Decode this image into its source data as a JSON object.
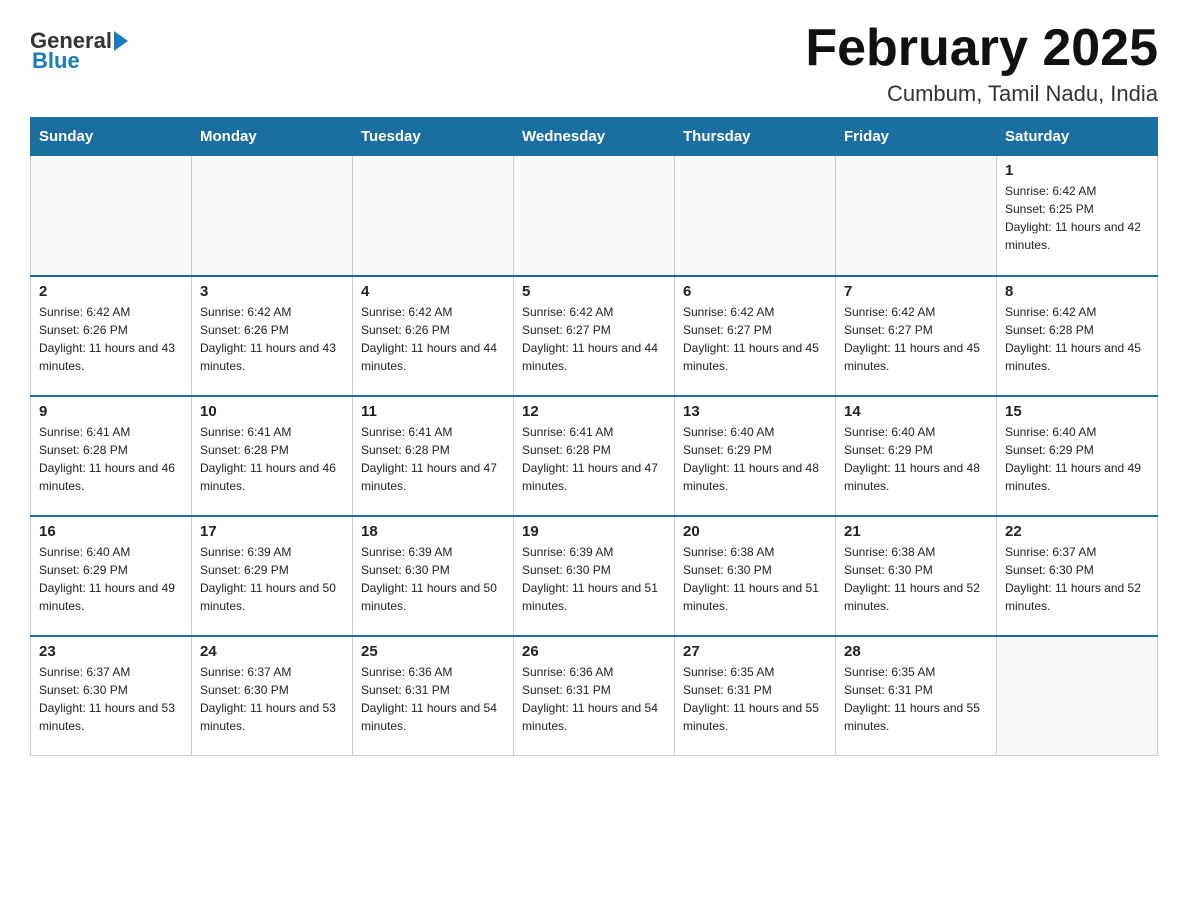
{
  "logo": {
    "general": "General",
    "blue": "Blue"
  },
  "title": "February 2025",
  "location": "Cumbum, Tamil Nadu, India",
  "days_of_week": [
    "Sunday",
    "Monday",
    "Tuesday",
    "Wednesday",
    "Thursday",
    "Friday",
    "Saturday"
  ],
  "weeks": [
    [
      {
        "day": "",
        "info": ""
      },
      {
        "day": "",
        "info": ""
      },
      {
        "day": "",
        "info": ""
      },
      {
        "day": "",
        "info": ""
      },
      {
        "day": "",
        "info": ""
      },
      {
        "day": "",
        "info": ""
      },
      {
        "day": "1",
        "info": "Sunrise: 6:42 AM\nSunset: 6:25 PM\nDaylight: 11 hours and 42 minutes."
      }
    ],
    [
      {
        "day": "2",
        "info": "Sunrise: 6:42 AM\nSunset: 6:26 PM\nDaylight: 11 hours and 43 minutes."
      },
      {
        "day": "3",
        "info": "Sunrise: 6:42 AM\nSunset: 6:26 PM\nDaylight: 11 hours and 43 minutes."
      },
      {
        "day": "4",
        "info": "Sunrise: 6:42 AM\nSunset: 6:26 PM\nDaylight: 11 hours and 44 minutes."
      },
      {
        "day": "5",
        "info": "Sunrise: 6:42 AM\nSunset: 6:27 PM\nDaylight: 11 hours and 44 minutes."
      },
      {
        "day": "6",
        "info": "Sunrise: 6:42 AM\nSunset: 6:27 PM\nDaylight: 11 hours and 45 minutes."
      },
      {
        "day": "7",
        "info": "Sunrise: 6:42 AM\nSunset: 6:27 PM\nDaylight: 11 hours and 45 minutes."
      },
      {
        "day": "8",
        "info": "Sunrise: 6:42 AM\nSunset: 6:28 PM\nDaylight: 11 hours and 45 minutes."
      }
    ],
    [
      {
        "day": "9",
        "info": "Sunrise: 6:41 AM\nSunset: 6:28 PM\nDaylight: 11 hours and 46 minutes."
      },
      {
        "day": "10",
        "info": "Sunrise: 6:41 AM\nSunset: 6:28 PM\nDaylight: 11 hours and 46 minutes."
      },
      {
        "day": "11",
        "info": "Sunrise: 6:41 AM\nSunset: 6:28 PM\nDaylight: 11 hours and 47 minutes."
      },
      {
        "day": "12",
        "info": "Sunrise: 6:41 AM\nSunset: 6:28 PM\nDaylight: 11 hours and 47 minutes."
      },
      {
        "day": "13",
        "info": "Sunrise: 6:40 AM\nSunset: 6:29 PM\nDaylight: 11 hours and 48 minutes."
      },
      {
        "day": "14",
        "info": "Sunrise: 6:40 AM\nSunset: 6:29 PM\nDaylight: 11 hours and 48 minutes."
      },
      {
        "day": "15",
        "info": "Sunrise: 6:40 AM\nSunset: 6:29 PM\nDaylight: 11 hours and 49 minutes."
      }
    ],
    [
      {
        "day": "16",
        "info": "Sunrise: 6:40 AM\nSunset: 6:29 PM\nDaylight: 11 hours and 49 minutes."
      },
      {
        "day": "17",
        "info": "Sunrise: 6:39 AM\nSunset: 6:29 PM\nDaylight: 11 hours and 50 minutes."
      },
      {
        "day": "18",
        "info": "Sunrise: 6:39 AM\nSunset: 6:30 PM\nDaylight: 11 hours and 50 minutes."
      },
      {
        "day": "19",
        "info": "Sunrise: 6:39 AM\nSunset: 6:30 PM\nDaylight: 11 hours and 51 minutes."
      },
      {
        "day": "20",
        "info": "Sunrise: 6:38 AM\nSunset: 6:30 PM\nDaylight: 11 hours and 51 minutes."
      },
      {
        "day": "21",
        "info": "Sunrise: 6:38 AM\nSunset: 6:30 PM\nDaylight: 11 hours and 52 minutes."
      },
      {
        "day": "22",
        "info": "Sunrise: 6:37 AM\nSunset: 6:30 PM\nDaylight: 11 hours and 52 minutes."
      }
    ],
    [
      {
        "day": "23",
        "info": "Sunrise: 6:37 AM\nSunset: 6:30 PM\nDaylight: 11 hours and 53 minutes."
      },
      {
        "day": "24",
        "info": "Sunrise: 6:37 AM\nSunset: 6:30 PM\nDaylight: 11 hours and 53 minutes."
      },
      {
        "day": "25",
        "info": "Sunrise: 6:36 AM\nSunset: 6:31 PM\nDaylight: 11 hours and 54 minutes."
      },
      {
        "day": "26",
        "info": "Sunrise: 6:36 AM\nSunset: 6:31 PM\nDaylight: 11 hours and 54 minutes."
      },
      {
        "day": "27",
        "info": "Sunrise: 6:35 AM\nSunset: 6:31 PM\nDaylight: 11 hours and 55 minutes."
      },
      {
        "day": "28",
        "info": "Sunrise: 6:35 AM\nSunset: 6:31 PM\nDaylight: 11 hours and 55 minutes."
      },
      {
        "day": "",
        "info": ""
      }
    ]
  ]
}
